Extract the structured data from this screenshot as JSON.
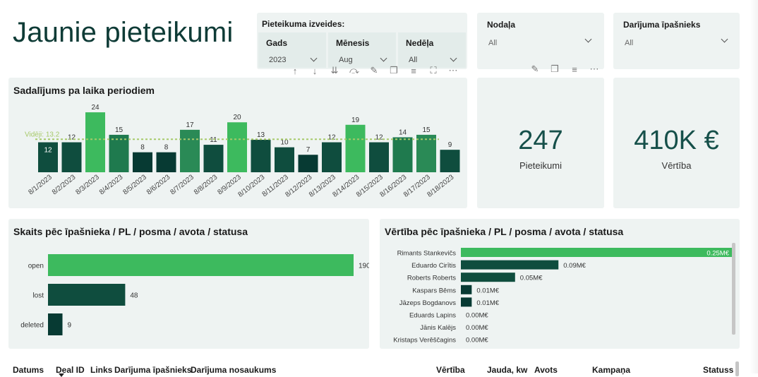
{
  "page_title": "Jaunie pieteikumi",
  "slicers": {
    "group_label": "Pieteikuma izveides:",
    "year": {
      "label": "Gads",
      "value": "2023"
    },
    "month": {
      "label": "Mēnesis",
      "value": "Aug"
    },
    "week": {
      "label": "Nedēļa",
      "value": "All"
    },
    "department": {
      "label": "Nodaļa",
      "value": "All"
    },
    "owner": {
      "label": "Darījuma īpašnieks",
      "value": "All"
    }
  },
  "time_chart": {
    "title": "Sadalījums pa laika periodiem",
    "average_label": "Vidēji: 13.2"
  },
  "kpis": {
    "count": {
      "value": "247",
      "label": "Pieteikumi"
    },
    "value": {
      "value": "410K €",
      "label": "Vērtība"
    }
  },
  "status_chart": {
    "title": "Skaits pēc īpašnieka / PL / posma / avota / statusa"
  },
  "value_chart": {
    "title": "Vērtība pēc īpašnieka / PL / posma / avota / statusa"
  },
  "table": {
    "columns": [
      "Datums",
      "Deal ID",
      "Links",
      "Darījuma īpašnieks",
      "Darījuma nosaukums",
      "Vērtība",
      "Jauda, kw",
      "Avots",
      "Kampaņa",
      "Statuss"
    ]
  },
  "colors": {
    "light_green": "#3dba5e",
    "mid_green": "#1f7a4e",
    "dark_green": "#0f4d3e",
    "darkest_green": "#073a33",
    "avg_line": "#a7c96a",
    "panel_bg": "#eef3f2"
  },
  "chart_data": [
    {
      "type": "bar",
      "title": "Sadalījums pa laika periodiem",
      "categories": [
        "8/1/2023",
        "8/2/2023",
        "8/3/2023",
        "8/4/2023",
        "8/5/2023",
        "8/6/2023",
        "8/7/2023",
        "8/8/2023",
        "8/9/2023",
        "8/10/2023",
        "8/11/2023",
        "8/12/2023",
        "8/13/2023",
        "8/14/2023",
        "8/15/2023",
        "8/16/2023",
        "8/17/2023",
        "8/18/2023"
      ],
      "values": [
        12,
        12,
        24,
        15,
        8,
        8,
        17,
        11,
        20,
        13,
        10,
        7,
        12,
        19,
        12,
        14,
        15,
        9
      ],
      "bar_colors": [
        "#0f4d3e",
        "#0f4d3e",
        "#3dba5e",
        "#1f7a4e",
        "#073a33",
        "#073a33",
        "#2a8a56",
        "#0f4d3e",
        "#3dba5e",
        "#0f4d3e",
        "#0f4d3e",
        "#073a33",
        "#0f4d3e",
        "#3dba5e",
        "#0f4d3e",
        "#1f7a4e",
        "#2a8a56",
        "#0f4d3e"
      ],
      "average": 13.2,
      "ylim": [
        0,
        26
      ],
      "grid": false
    },
    {
      "type": "bar",
      "orientation": "horizontal",
      "title": "Skaits pēc īpašnieka / PL / posma / avota / statusa",
      "categories": [
        "open",
        "lost",
        "deleted"
      ],
      "values": [
        190,
        48,
        9
      ],
      "bar_colors": [
        "#3dba5e",
        "#0f4d3e",
        "#073a33"
      ],
      "xlim": [
        0,
        190
      ]
    },
    {
      "type": "bar",
      "orientation": "horizontal",
      "title": "Vērtība pēc īpašnieka / PL / posma / avota / statusa",
      "categories": [
        "Rimants Stankevičs",
        "Eduardo Cirītis",
        "Roberts Roberts",
        "Kaspars Bēms",
        "Jāzeps Bogdanovs",
        "Eduards Lapins",
        "Jānis Kalējs",
        "Kristaps Verēščagins"
      ],
      "values": [
        0.25,
        0.09,
        0.05,
        0.01,
        0.01,
        0.0,
        0.0,
        0.0
      ],
      "value_labels": [
        "0.25M€",
        "0.09M€",
        "0.05M€",
        "0.01M€",
        "0.01M€",
        "0.00M€",
        "0.00M€",
        "0.00M€"
      ],
      "bar_colors": [
        "#3dba5e",
        "#0f4d3e",
        "#0f4d3e",
        "#073a33",
        "#073a33",
        "#073a33",
        "#073a33",
        "#073a33"
      ],
      "xlim": [
        0,
        0.25
      ]
    }
  ]
}
